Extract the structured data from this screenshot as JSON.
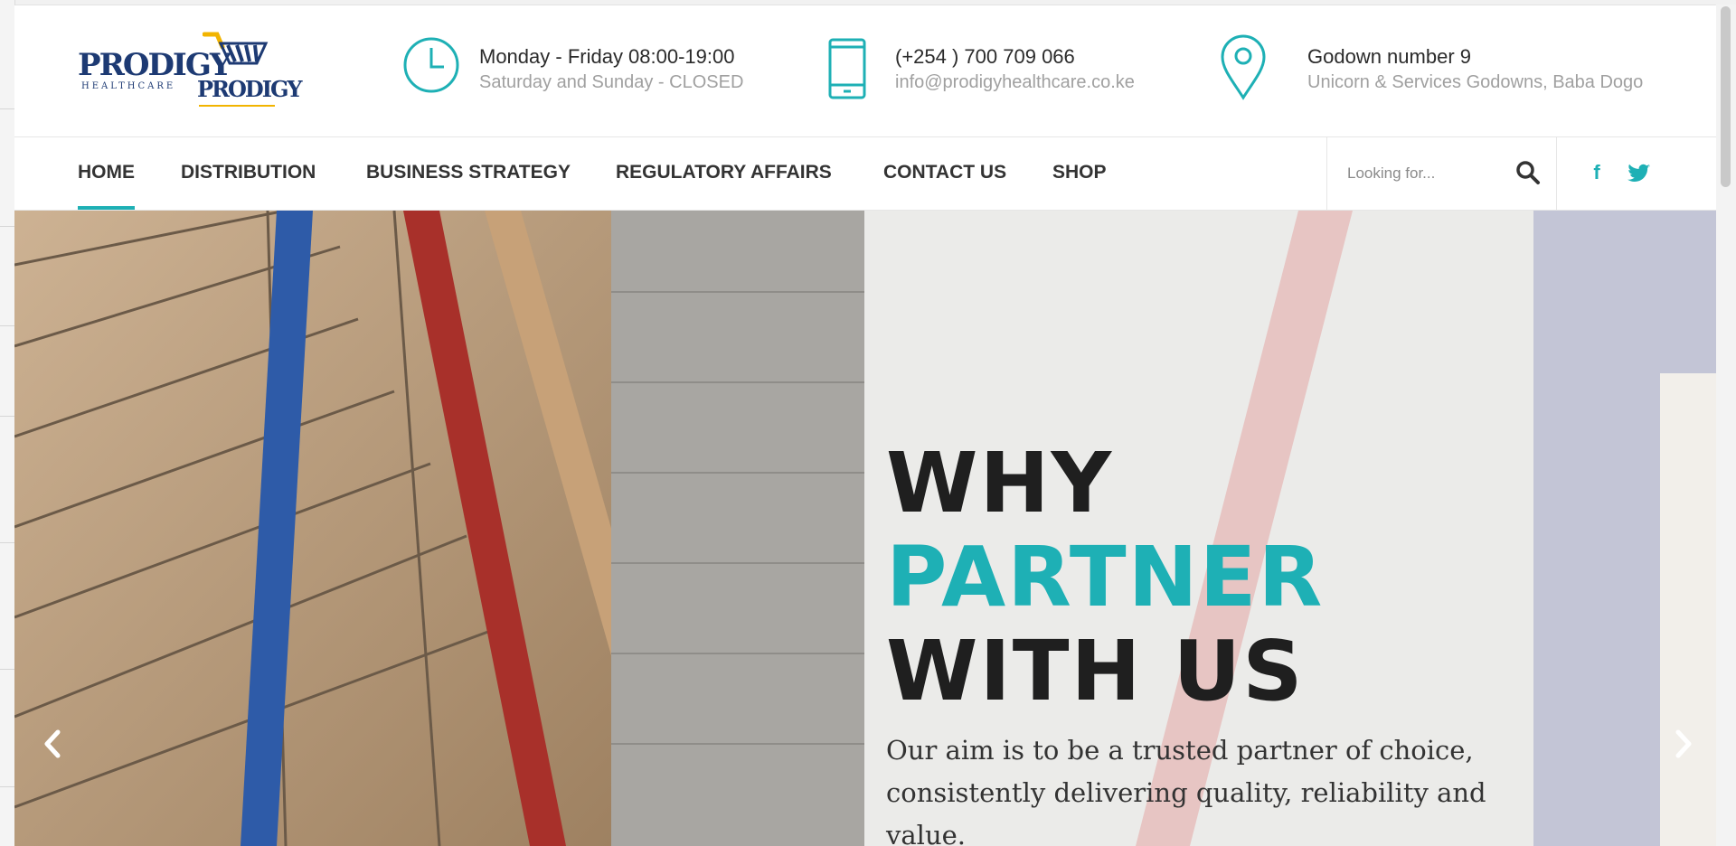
{
  "brand": {
    "logo_primary": "PRODIGY",
    "logo_primary_sub": "HEALTHCARE",
    "logo_secondary": "PRODIGY",
    "colors": {
      "accent": "#1eb0b5",
      "brand_blue": "#1d3a73",
      "brand_gold": "#f2b400"
    }
  },
  "header": {
    "hours": {
      "icon": "clock-icon",
      "line1": "Monday - Friday 08:00-19:00",
      "line2": "Saturday and Sunday - CLOSED"
    },
    "contact": {
      "icon": "mobile-phone-icon",
      "line1": "(+254 ) 700 709 066",
      "line2": "info@prodigyhealthcare.co.ke"
    },
    "location": {
      "icon": "map-pin-icon",
      "line1": "Godown number 9",
      "line2": "Unicorn & Services Godowns, Baba Dogo"
    }
  },
  "nav": {
    "items": [
      {
        "label": "HOME",
        "active": true
      },
      {
        "label": "DISTRIBUTION"
      },
      {
        "label": "BUSINESS STRATEGY"
      },
      {
        "label": "REGULATORY AFFAIRS"
      },
      {
        "label": "CONTACT US"
      },
      {
        "label": "SHOP"
      }
    ],
    "search": {
      "placeholder": "Looking for...",
      "icon": "search-icon"
    },
    "social": [
      {
        "label": "f",
        "icon": "facebook-icon"
      },
      {
        "label": "twitter",
        "icon": "twitter-icon"
      }
    ]
  },
  "hero": {
    "title_line1": "WHY",
    "title_line2": "PARTNER",
    "title_line3": "WITH US",
    "description": "Our aim is to be a trusted partner of choice, consistently delivering quality, reliability and value.",
    "prev_icon": "chevron-left-icon",
    "next_icon": "chevron-right-icon"
  }
}
